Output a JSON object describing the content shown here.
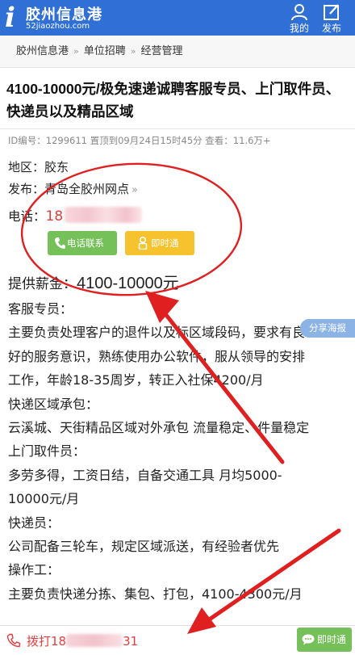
{
  "header": {
    "logo_mark": "i",
    "logo_name": "胶州信息港",
    "logo_url": "52jiaozhou.com",
    "mine_label": "我的",
    "post_label": "发布"
  },
  "breadcrumb": [
    "胶州信息港",
    "单位招聘",
    "经营管理"
  ],
  "post": {
    "title": "4100-10000元/极免速递诚聘客服专员、上门取件员、快递员以及精品区域",
    "meta": "ID编号：1299611  置顶到09月24日15时45分  查看：11.6万+",
    "area_label": "地区：",
    "area_value": "胶东",
    "publisher_label": "发布：",
    "publisher_value": "青岛全胶州网点",
    "phone_label": "电话：",
    "phone_prefix": "18",
    "call_button": "电话联系",
    "chat_button": "即时通",
    "salary_label": "提供薪金：",
    "salary_value": "4100-10000元",
    "body_lines": [
      "客服专员：",
      "主要负责处理客户的退件以及标区域段码，要求有良",
      "好的服务意识，熟练使用办公软件，服从领导的安排",
      "工作，年龄18-35周岁，转正入社保4200/月",
      "快递区域承包：",
      "云溪城、天街精品区域对外承包 流量稳定、件量稳定",
      "上门取件员：",
      "多劳多得，工资日结，自备交通工具 月均5000-",
      "10000元/月",
      "快递员：",
      "公司配备三轮车，规定区域派送，有经验者优先",
      "操作工：",
      "主要负责快递分拣、集包、打包，4100-4300元/月"
    ],
    "share_label": "分享海报"
  },
  "bottom": {
    "dial_prefix": "拨打18",
    "dial_suffix": "31",
    "chat_label": "即时通"
  },
  "colors": {
    "brand": "#2f6fd6",
    "phone_red": "#e53d3d",
    "call_green": "#76c05a",
    "chat_yellow": "#f6c22d",
    "annotation_red": "#e02020"
  }
}
